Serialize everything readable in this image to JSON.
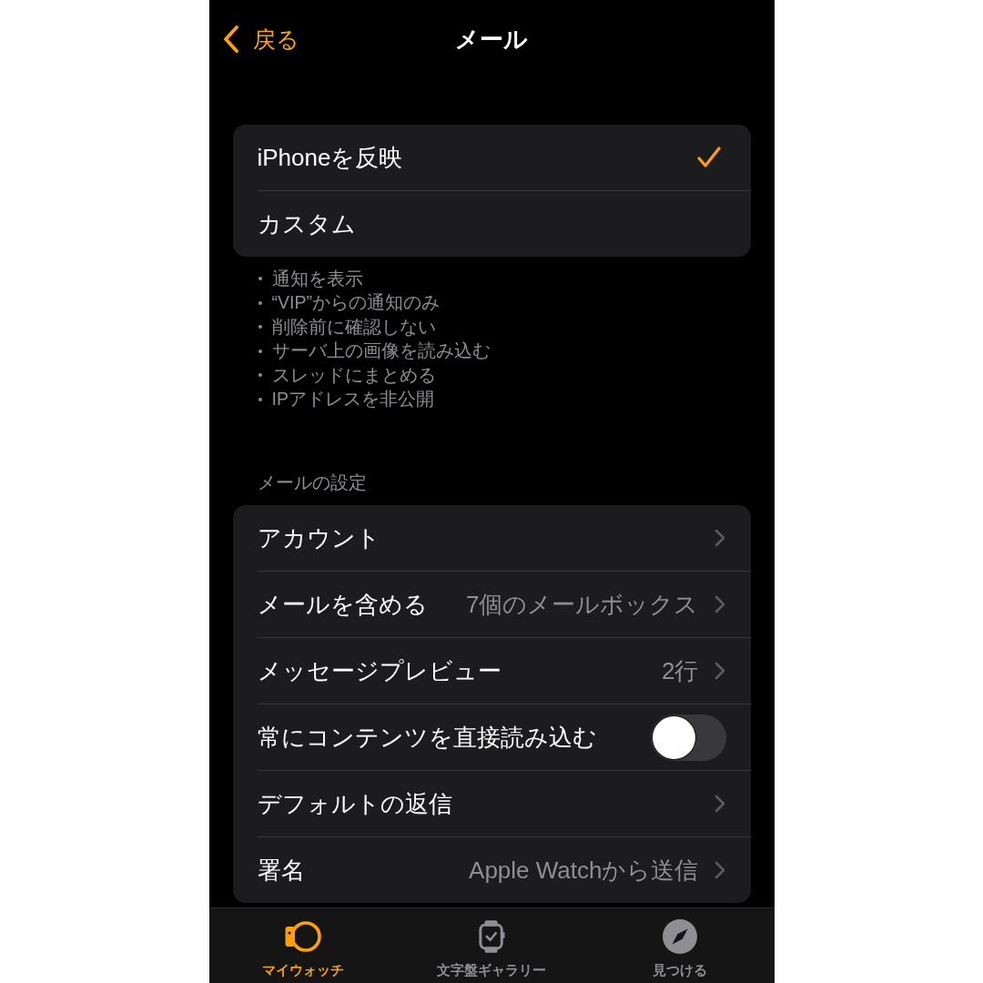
{
  "nav": {
    "back": "戻る",
    "title": "メール"
  },
  "mode_options": [
    {
      "label": "iPhoneを反映",
      "selected": true
    },
    {
      "label": "カスタム",
      "selected": false
    }
  ],
  "mirrored_settings": [
    "通知を表示",
    "“VIP”からの通知のみ",
    "削除前に確認しない",
    "サーバ上の画像を読み込む",
    "スレッドにまとめる",
    "IPアドレスを非公開"
  ],
  "section_header": "メールの設定",
  "settings": [
    {
      "kind": "link",
      "label": "アカウント"
    },
    {
      "kind": "link",
      "label": "メールを含める",
      "value": "7個のメールボックス"
    },
    {
      "kind": "link",
      "label": "メッセージプレビュー",
      "value": "2行"
    },
    {
      "kind": "toggle",
      "label": "常にコンテンツを直接読み込む",
      "on": false
    },
    {
      "kind": "link",
      "label": "デフォルトの返信"
    },
    {
      "kind": "link",
      "label": "署名",
      "value": "Apple Watchから送信"
    }
  ],
  "tab_bar": [
    {
      "label": "マイウォッチ",
      "selected": true
    },
    {
      "label": "文字盤ギャラリー",
      "selected": false
    },
    {
      "label": "見つける",
      "selected": false
    }
  ]
}
